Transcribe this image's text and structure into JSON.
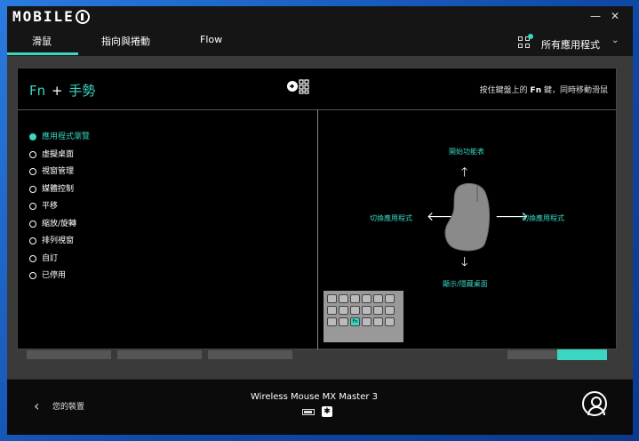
{
  "app": {
    "logo_text": "MOBILE01"
  },
  "window_controls": {
    "minimize": "—",
    "close": "✕"
  },
  "nav": {
    "tabs": [
      {
        "label": "滑鼠",
        "active": true
      },
      {
        "label": "指向與捲動",
        "active": false
      },
      {
        "label": "Flow",
        "active": false
      }
    ],
    "apps_selector": "所有應用程式"
  },
  "modal": {
    "title_key": "Fn",
    "title_plus": "+",
    "title_action": "手勢",
    "hint_prefix": "按住鍵盤上的",
    "hint_key": "Fn",
    "hint_suffix": "鍵，同時移動滑鼠",
    "options": [
      {
        "label": "應用程式瀏覽",
        "selected": true
      },
      {
        "label": "虛擬桌面",
        "selected": false
      },
      {
        "label": "視窗管理",
        "selected": false
      },
      {
        "label": "媒體控制",
        "selected": false
      },
      {
        "label": "平移",
        "selected": false
      },
      {
        "label": "縮放/旋轉",
        "selected": false
      },
      {
        "label": "排列視窗",
        "selected": false
      },
      {
        "label": "自訂",
        "selected": false
      },
      {
        "label": "已停用",
        "selected": false
      }
    ],
    "gesture": {
      "up": "開始功能表",
      "left": "切換應用程式",
      "right": "切換應用程式",
      "down": "顯示/隱藏桌面"
    },
    "keyboard_key": "Fn"
  },
  "footer": {
    "back_label": "您的裝置",
    "device_name": "Wireless Mouse MX Master 3"
  },
  "colors": {
    "accent": "#3ad6c2",
    "background": "#151515",
    "modal": "#000000"
  }
}
